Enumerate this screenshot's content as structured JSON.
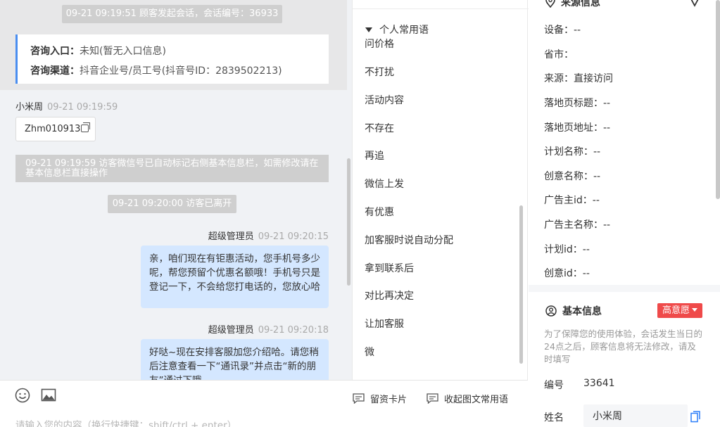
{
  "chat": {
    "sys1": "09-21 09:19:51 顾客发起会话，会话编号：36933",
    "entry": {
      "label1": "咨询入口：",
      "value1": "未知(暂无入口信息)",
      "label2": "咨询渠道：",
      "value2": "抖音企业号/员工号(抖音号ID：2839502213)"
    },
    "visitor_msg": {
      "sender": "小米周",
      "time": "09-21 09:19:59",
      "wechat": "Zhm010913"
    },
    "sys2": "09-21 09:19:59 访客微信号已自动标记右侧基本信息栏，如需修改请在基本信息栏直接操作",
    "sys3": "09-21 09:20:00 访客已离开",
    "agent_msg1": {
      "sender": "超级管理员",
      "time": "09-21 09:20:15",
      "text": "亲，咱们现在有钜惠活动，您手机号多少呢，帮您预留个优惠名额哦！手机号只是登记一下，不会给您打电话的，您放心哈"
    },
    "agent_msg2": {
      "sender": "超级管理员",
      "time": "09-21 09:20:18",
      "text": "好哒~现在安排客服加您介绍哈。请您稍后注意查看一下“通讯录”并点击“新的朋友”通过下哦"
    }
  },
  "input": {
    "placeholder": "请输入您的内容（换行快捷键：shift/ctrl + enter）",
    "card_button": "留资卡片",
    "collapse_button": "收起图文常用语",
    "emoji_icon": "smile-icon",
    "image_icon": "image-icon"
  },
  "phrases": {
    "group": "个人常用语",
    "items": [
      "问价格",
      "不打扰",
      "活动内容",
      "不存在",
      "再追",
      "微信上发",
      "有优惠",
      "加客服时说自动分配",
      "拿到联系后",
      "对比再决定",
      "让加客服",
      "微"
    ]
  },
  "info": {
    "source_title": "来源信息",
    "fields": [
      "设备：--",
      "省市：",
      "来源：直接访问",
      "落地页标题：--",
      "落地页地址：--",
      "计划名称：--",
      "创意名称：--",
      "广告主id：--",
      "广告主名称：--",
      "计划id：--",
      "创意id：--"
    ],
    "basic_title": "基本信息",
    "intent_badge": "高意愿",
    "notice": "为了保障您的使用体验，会话发生当日的24点之后，顾客信息将无法修改，请及时填写",
    "id_label": "编号",
    "id_value": "33641",
    "name_label": "姓名",
    "name_value": "小米周"
  },
  "colors": {
    "accent_blue": "#4a8ef0",
    "bubble_blue": "#d4e7ff",
    "badge_red": "#ef4a4a"
  }
}
